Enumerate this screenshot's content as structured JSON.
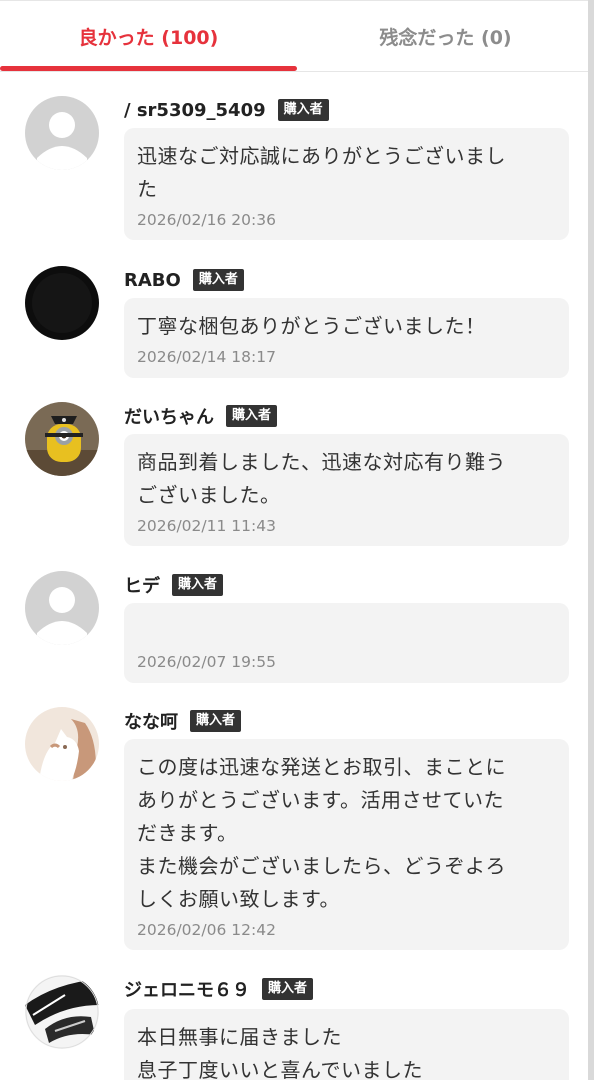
{
  "tabs": {
    "good": "良かった (100)",
    "bad": "残念だった (0)"
  },
  "colors": {
    "accent": "#e6323c",
    "badge": "#333333",
    "bubble": "#f3f3f3"
  },
  "reviews": [
    {
      "name": "/ sr5309_5409",
      "badge": "購入者",
      "avatar": "default-avatar-icon",
      "comment": "迅速なご対応誠にありがとうございまし\nた",
      "date": "2026/02/16 20:36"
    },
    {
      "name": "RABO",
      "badge": "購入者",
      "avatar": "black-circle-avatar",
      "comment": "丁寧な梱包ありがとうございました！",
      "date": "2026/02/14 18:17"
    },
    {
      "name": "だいちゃん",
      "badge": "購入者",
      "avatar": "minion-photo-avatar",
      "comment": "商品到着しました、迅速な対応有り難う\nございました。",
      "date": "2026/02/11 11:43"
    },
    {
      "name": "ヒデ",
      "badge": "購入者",
      "avatar": "default-avatar-icon",
      "comment": "",
      "date": "2026/02/07 19:55"
    },
    {
      "name": "なな呵",
      "badge": "購入者",
      "avatar": "cat-illustration-avatar",
      "comment": "この度は迅速な発送とお取引、まことに\nありがとうございます。活用させていた\nだきます。\nまた機会がございましたら、どうぞよろ\nしくお願い致します。",
      "date": "2026/02/06 12:42"
    },
    {
      "name": "ジェロニモ６９",
      "badge": "購入者",
      "avatar": "sketch-photo-avatar",
      "comment": "本日無事に届きました\n息子丁度いいと喜んでいました",
      "date": ""
    }
  ]
}
